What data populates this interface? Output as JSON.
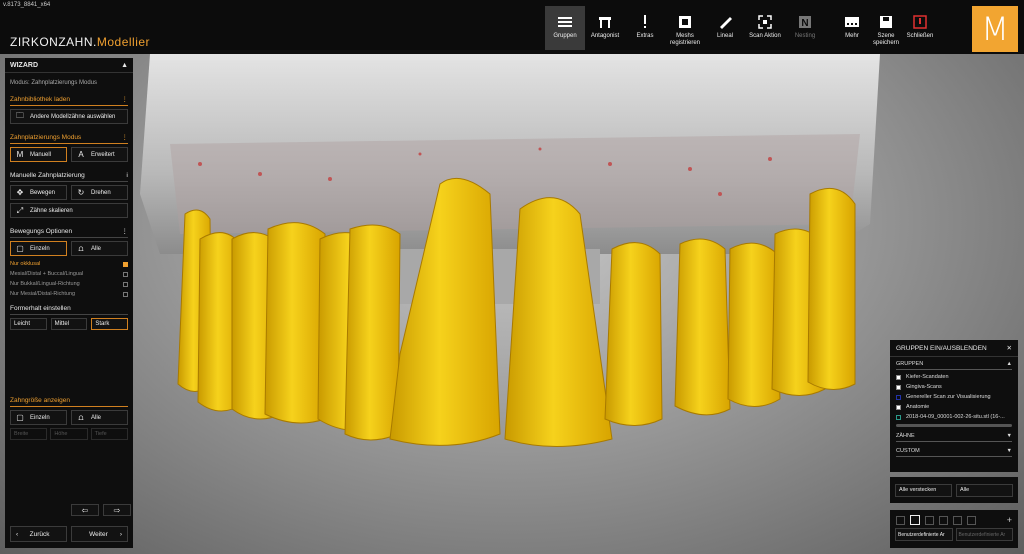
{
  "app": {
    "version": "v.8173_8841_x64",
    "brand_main": "ZIRKONZAHN.",
    "brand_accent": "Modellier"
  },
  "toolbar": [
    {
      "id": "gruppen",
      "label": "Gruppen",
      "icon": "hamburger-icon",
      "active": true
    },
    {
      "id": "antagonist",
      "label": "Antagonist",
      "icon": "antagonist-icon"
    },
    {
      "id": "extras",
      "label": "Extras",
      "icon": "exclamation-icon"
    },
    {
      "id": "meshs",
      "label": "Meshs registrieren",
      "icon": "mesh-register-icon"
    },
    {
      "id": "lineal",
      "label": "Lineal",
      "icon": "ruler-icon"
    },
    {
      "id": "scanaktion",
      "label": "Scan Aktion",
      "icon": "scan-action-icon"
    },
    {
      "id": "nesting",
      "label": "Nesting",
      "icon": "nesting-icon",
      "disabled": true
    }
  ],
  "toolbar2": [
    {
      "id": "mehr",
      "label": "Mehr",
      "icon": "more-icon"
    },
    {
      "id": "speichern",
      "label": "Szene speichern",
      "icon": "save-icon"
    },
    {
      "id": "schliessen",
      "label": "Schließen",
      "icon": "power-icon"
    }
  ],
  "logo_letter": "M",
  "wizard": {
    "title": "WIZARD",
    "mode": "Modus: Zahnplatzierungs Modus",
    "lib_section": "Zahnbibliothek laden",
    "lib_button": "Andere Modellzähne auswählen",
    "place_section": "Zahnplatzierungs Modus",
    "manual_btn": "Manuell",
    "extended_btn": "Erweitert",
    "manual_section": "Manuelle Zahnplatzierung",
    "move_btn": "Bewegen",
    "rotate_btn": "Drehen",
    "scale_btn": "Zähne skalieren",
    "move_options_section": "Bewegungs Optionen",
    "single_btn": "Einzeln",
    "all_btn": "Alle",
    "options": [
      {
        "label": "Nur okklusal",
        "checked": true
      },
      {
        "label": "Mesial/Distal + Buccal/Lingual",
        "checked": false
      },
      {
        "label": "Nur Bukkal/Lingual-Richtung",
        "checked": false
      },
      {
        "label": "Nur Mesial/Distal-Richtung",
        "checked": false
      }
    ],
    "shape_section": "Formerhalt einstellen",
    "shape_buttons": [
      "Leicht",
      "Mittel",
      "Stark"
    ],
    "size_section": "Zahngröße anzeigen",
    "size_single": "Einzeln",
    "size_all": "Alle",
    "size_inputs": [
      "Breite",
      "Höhe",
      "Tiefe"
    ],
    "back": "Zurück",
    "next": "Weiter"
  },
  "groups": {
    "title": "GRUPPEN EIN/AUSBLENDEN",
    "section": "GRUPPEN",
    "items": [
      {
        "label": "Kiefer-Scandaten",
        "state": "on"
      },
      {
        "label": "Gingiva-Scans",
        "state": "on"
      },
      {
        "label": "Genereller Scan zur Visualisierung",
        "state": "dark"
      },
      {
        "label": "Anatomie",
        "state": "on"
      },
      {
        "label": "2018-04-09_00001-002-26-situ.stl (16-...",
        "state": "cyan"
      }
    ],
    "teeth_section": "ZÄHNE",
    "custom_section": "CUSTOM",
    "hide_all": "Alle verstecken",
    "all": "Alle",
    "custom1": "Benutzerdefinierte Ar",
    "custom2": "Benutzerdefinierte Ar"
  },
  "colors": {
    "accent": "#f0a030",
    "tooth": "#f1c40f",
    "gum": "#c06060",
    "panel": "#0e0e0e"
  }
}
